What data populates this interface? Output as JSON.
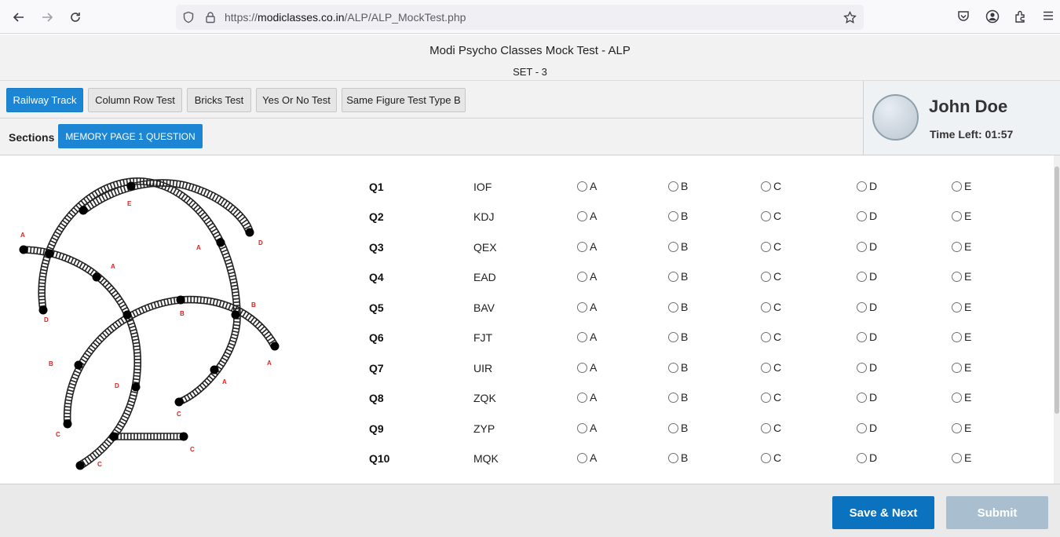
{
  "browser": {
    "url_prefix": "https://",
    "url_host": "modiclasses.co.in",
    "url_path": "/ALP/ALP_MockTest.php"
  },
  "header": {
    "title": "Modi Psycho Classes Mock Test - ALP",
    "subtitle": "SET - 3"
  },
  "tests": [
    {
      "label": "Railway Track",
      "active": true
    },
    {
      "label": "Column Row Test",
      "active": false
    },
    {
      "label": "Bricks Test",
      "active": false
    },
    {
      "label": "Yes Or No Test",
      "active": false
    },
    {
      "label": "Same Figure Test Type B",
      "active": false
    }
  ],
  "sections": {
    "label": "Sections",
    "current": "MEMORY PAGE 1 QUESTION"
  },
  "candidate": {
    "name": "John Doe",
    "time_left": "Time Left: 01:57"
  },
  "figure": {
    "labels": [
      "A",
      "E",
      "D",
      "A",
      "A",
      "D",
      "B",
      "B",
      "B",
      "A",
      "D",
      "A",
      "C",
      "C",
      "C",
      "C"
    ]
  },
  "options": [
    "A",
    "B",
    "C",
    "D",
    "E"
  ],
  "questions": [
    {
      "num": "Q1",
      "code": "IOF"
    },
    {
      "num": "Q2",
      "code": "KDJ"
    },
    {
      "num": "Q3",
      "code": "QEX"
    },
    {
      "num": "Q4",
      "code": "EAD"
    },
    {
      "num": "Q5",
      "code": "BAV"
    },
    {
      "num": "Q6",
      "code": "FJT"
    },
    {
      "num": "Q7",
      "code": "UIR"
    },
    {
      "num": "Q8",
      "code": "ZQK"
    },
    {
      "num": "Q9",
      "code": "ZYP"
    },
    {
      "num": "Q10",
      "code": "MQK"
    }
  ],
  "footer": {
    "save_label": "Save & Next",
    "submit_label": "Submit"
  },
  "colors": {
    "accent": "#1c86d4",
    "save": "#0b72c0",
    "submit_disabled": "#a9bfd0",
    "station_label": "#e02020"
  }
}
